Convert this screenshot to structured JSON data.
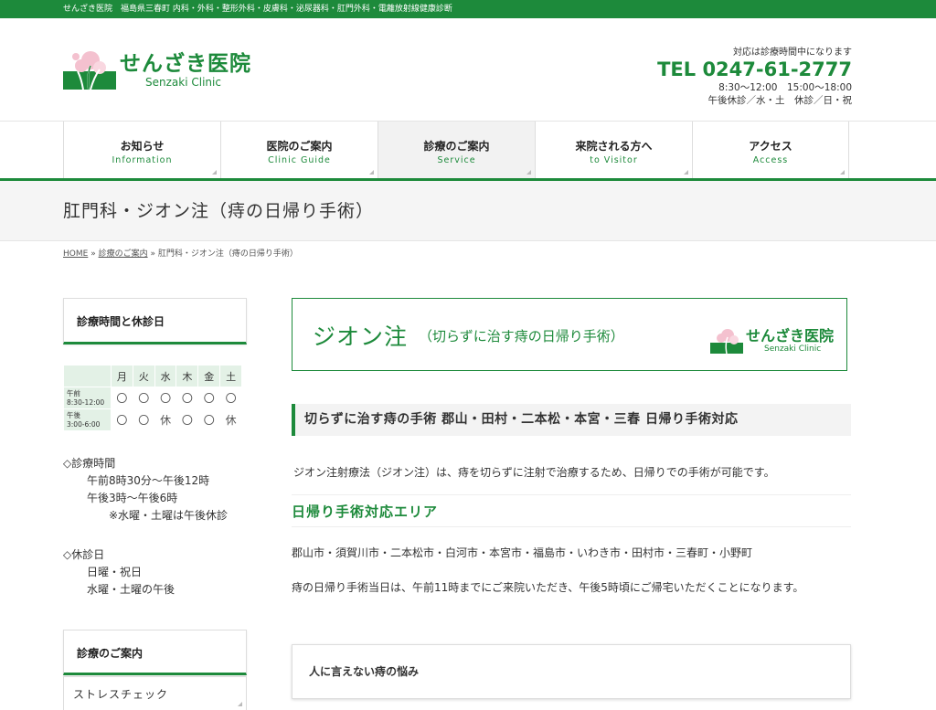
{
  "topbar": {
    "text": "せんざき医院　福島県三春町 内科・外科・整形外科・皮膚科・泌尿器科・肛門外科・電離放射線健康診断"
  },
  "header": {
    "logo_ja": "せんざき医院",
    "logo_en": "Senzaki Clinic",
    "contact_note": "対応は診療時間中になります",
    "tel": "TEL 0247-61-2777",
    "hours": "8:30〜12:00　15:00〜18:00",
    "closed": "午後休診／水・土　休診／日・祝"
  },
  "nav": [
    {
      "ja": "お知らせ",
      "en": "Information"
    },
    {
      "ja": "医院のご案内",
      "en": "Clinic Guide"
    },
    {
      "ja": "診療のご案内",
      "en": "Service"
    },
    {
      "ja": "来院される方へ",
      "en": "to Visitor"
    },
    {
      "ja": "アクセス",
      "en": "Access"
    }
  ],
  "page_title": "肛門科・ジオン注（痔の日帰り手術）",
  "breadcrumb": {
    "home": "HOME",
    "sep": "»",
    "level2": "診療のご案内",
    "current": "肛門科・ジオン注（痔の日帰り手術）"
  },
  "sidebar": {
    "hours_title": "診療時間と休診日",
    "table": {
      "days": [
        "月",
        "火",
        "水",
        "木",
        "金",
        "土"
      ],
      "am_label_1": "午前",
      "am_label_2": "8:30-12:00",
      "pm_label_1": "午後",
      "pm_label_2": "3:00-6:00",
      "am": [
        "〇",
        "〇",
        "〇",
        "〇",
        "〇",
        "〇"
      ],
      "pm": [
        "〇",
        "〇",
        "休",
        "〇",
        "〇",
        "休"
      ]
    },
    "hours_heading": "◇診療時間",
    "hours_am": "午前8時30分〜午後12時",
    "hours_pm": "午後3時〜午後6時",
    "hours_note": "※水曜・土曜は午後休診",
    "closed_heading": "◇休診日",
    "closed_1": "日曜・祝日",
    "closed_2": "水曜・土曜の午後",
    "service_title": "診療のご案内",
    "service_item_1": "ストレスチェック"
  },
  "main": {
    "banner_big": "ジオン注",
    "banner_small": "（切らずに治す痔の日帰り手術）",
    "banner_logo_ja": "せんざき医院",
    "banner_logo_en": "Senzaki Clinic",
    "h2": "切らずに治す痔の手術 郡山・田村・二本松・本宮・三春 日帰り手術対応",
    "p1": "ジオン注射療法（ジオン注）は、痔を切らずに注射で治療するため、日帰りでの手術が可能です。",
    "h3": "日帰り手術対応エリア",
    "p2": "郡山市・須賀川市・二本松市・白河市・本宮市・福島市・いわき市・田村市・三春町・小野町",
    "p3": "痔の日帰り手術当日は、午前11時までにご来院いただき、午後5時頃にご帰宅いただくことになります。",
    "box3_title": "人に言えない痔の悩み"
  },
  "colors": {
    "accent": "#1d8a3b"
  }
}
